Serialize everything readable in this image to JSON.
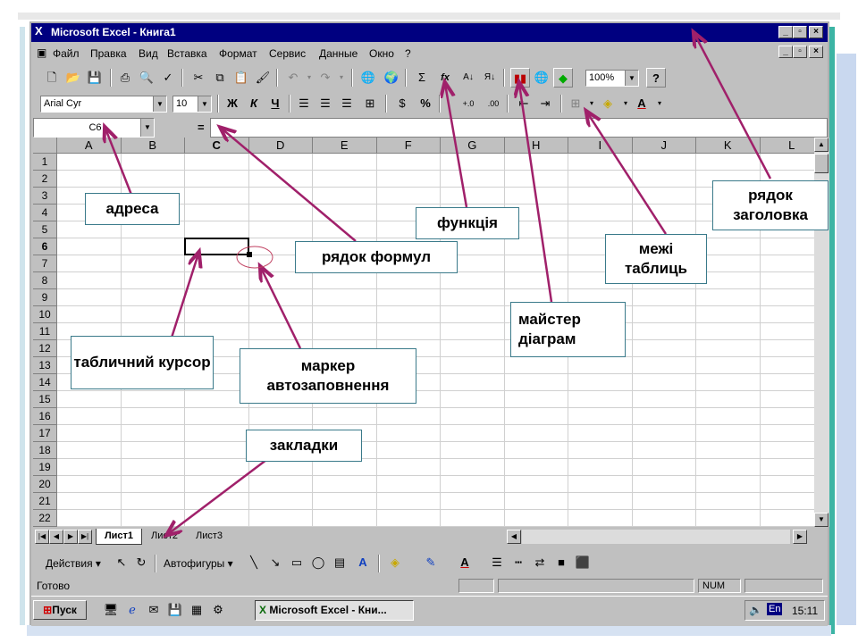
{
  "window": {
    "title": "Microsoft Excel - Книга1",
    "min": "_",
    "max": "▫",
    "close": "×"
  },
  "menu": [
    "Файл",
    "Правка",
    "Вид",
    "Вставка",
    "Формат",
    "Сервис",
    "Данные",
    "Окно",
    "?"
  ],
  "toolbar": {
    "zoom": "100%",
    "font": "Arial Cyr",
    "size": "10",
    "bold": "Ж",
    "italic": "К",
    "underline": "Ч",
    "percent": "%",
    "sum": "Σ",
    "fx": "fx"
  },
  "formula_bar": {
    "address": "C6",
    "equals": "="
  },
  "columns": [
    "A",
    "B",
    "C",
    "D",
    "E",
    "F",
    "G",
    "H",
    "I",
    "J",
    "K",
    "L"
  ],
  "rows": [
    "1",
    "2",
    "3",
    "4",
    "5",
    "6",
    "7",
    "8",
    "9",
    "10",
    "11",
    "12",
    "13",
    "14",
    "15",
    "16",
    "17",
    "18",
    "19",
    "20",
    "21",
    "22"
  ],
  "sheet_tabs": [
    "Лист1",
    "Лист2",
    "Лист3"
  ],
  "drawing": {
    "actions": "Действия",
    "autoshapes": "Автофигуры"
  },
  "status": {
    "ready": "Готово",
    "num": "NUM"
  },
  "taskbar": {
    "start": "Пуск",
    "task": "Microsoft Excel - Кни...",
    "lang": "En",
    "time": "15:11"
  },
  "callouts": {
    "address": "адреса",
    "function": "функція",
    "header_row": "рядок заголовка",
    "formula_row": "рядок формул",
    "borders": "межі таблиць",
    "chart_wizard": "майстер діаграм",
    "cursor": "табличний курсор",
    "autofill": "маркер автозаповнення",
    "tabs": "закладки"
  },
  "colors": {
    "titlebar": "#000080",
    "chrome": "#c0c0c0",
    "arrow": "#a0206a",
    "frame_accent": "#3cb4a4"
  }
}
